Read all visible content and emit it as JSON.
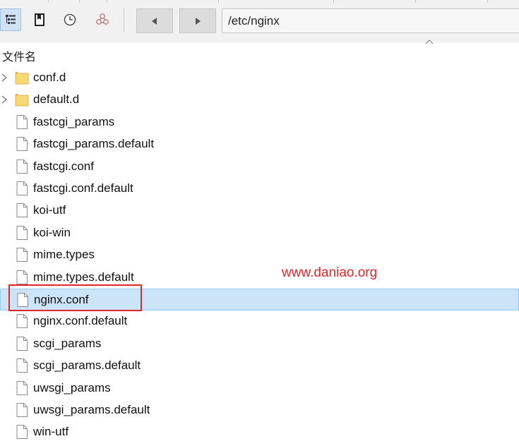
{
  "toolbar": {
    "buttons": [
      {
        "name": "tree-view-icon",
        "active": true
      },
      {
        "name": "bookmark-icon",
        "active": false
      },
      {
        "name": "history-clock-icon",
        "active": false
      },
      {
        "name": "sync-icon",
        "active": false
      }
    ],
    "back": "back-arrow-icon",
    "forward": "forward-arrow-icon"
  },
  "address": {
    "path": "/etc/nginx"
  },
  "column": {
    "name_header": "文件名",
    "sort": "ascending"
  },
  "files": [
    {
      "name": "conf.d",
      "type": "folder"
    },
    {
      "name": "default.d",
      "type": "folder"
    },
    {
      "name": "fastcgi_params",
      "type": "file"
    },
    {
      "name": "fastcgi_params.default",
      "type": "file"
    },
    {
      "name": "fastcgi.conf",
      "type": "file"
    },
    {
      "name": "fastcgi.conf.default",
      "type": "file"
    },
    {
      "name": "koi-utf",
      "type": "file"
    },
    {
      "name": "koi-win",
      "type": "file"
    },
    {
      "name": "mime.types",
      "type": "file"
    },
    {
      "name": "mime.types.default",
      "type": "file"
    },
    {
      "name": "nginx.conf",
      "type": "file",
      "selected": true
    },
    {
      "name": "nginx.conf.default",
      "type": "file"
    },
    {
      "name": "scgi_params",
      "type": "file"
    },
    {
      "name": "scgi_params.default",
      "type": "file"
    },
    {
      "name": "uwsgi_params",
      "type": "file"
    },
    {
      "name": "uwsgi_params.default",
      "type": "file"
    },
    {
      "name": "win-utf",
      "type": "file"
    }
  ],
  "watermark": {
    "text": "www.daniao.org"
  },
  "colors": {
    "selection": "#cce4f7",
    "highlight": "#e0262a",
    "folder": "#f8d775"
  }
}
